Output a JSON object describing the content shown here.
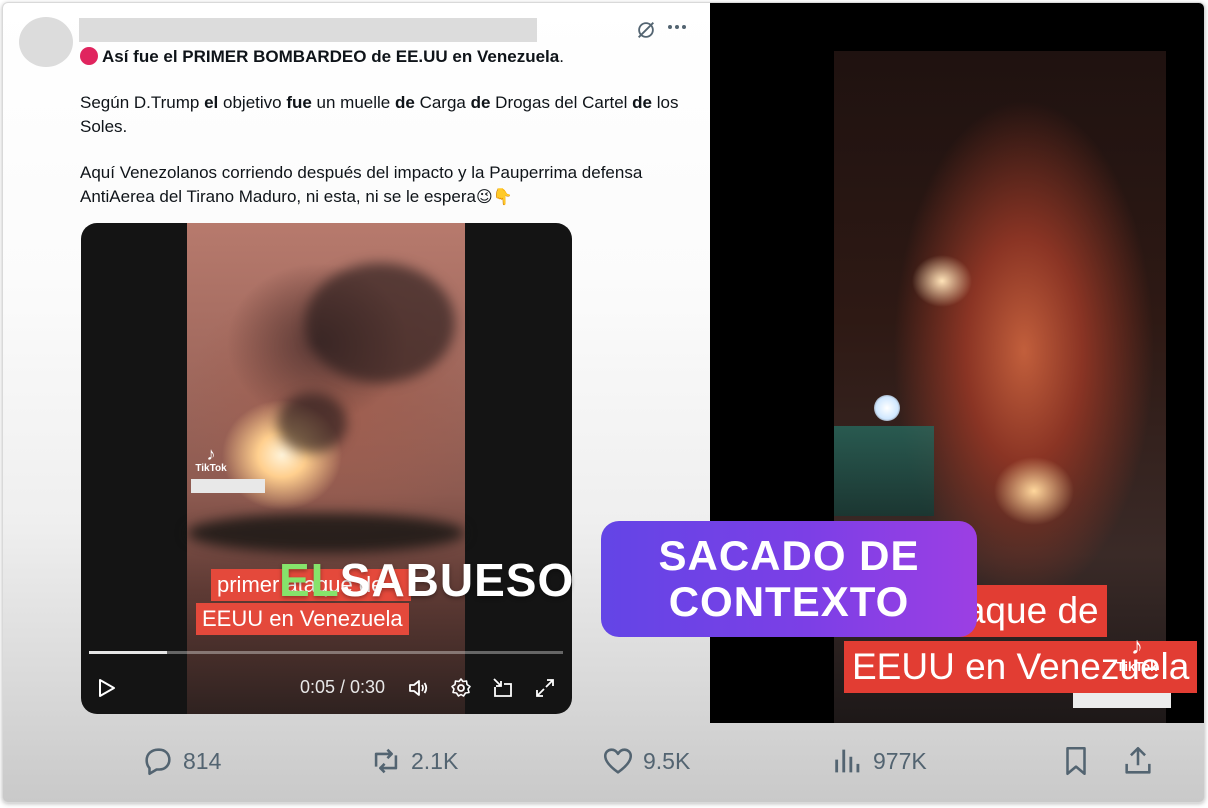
{
  "tweet": {
    "headline": "Así fue el PRIMER BOMBARDEO de EE.UU en Venezuela",
    "headline_end": ".",
    "para1": [
      {
        "t": "Según D.Trump ",
        "b": false
      },
      {
        "t": "el",
        "b": true
      },
      {
        "t": " objetivo ",
        "b": false
      },
      {
        "t": "fue",
        "b": true
      },
      {
        "t": " un muelle ",
        "b": false
      },
      {
        "t": "de",
        "b": true
      },
      {
        "t": " Carga ",
        "b": false
      },
      {
        "t": "de",
        "b": true
      },
      {
        "t": " Drogas del Cartel ",
        "b": false
      },
      {
        "t": "de",
        "b": true
      },
      {
        "t": " los Soles.",
        "b": false
      }
    ],
    "para2": "Aquí Venezolanos corriendo después del impacto y la Pauperrima defensa AntiAerea del Tirano Maduro, ni esta, ni se le espera",
    "emoji1": "😉",
    "emoji2": "👇"
  },
  "video": {
    "caption1": "primer ataque de",
    "caption2": "EEUU en Venezuela",
    "tiktok": "TikTok",
    "time": "0:05 / 0:30",
    "progress": 0.165
  },
  "side": {
    "caption1": "ataque de",
    "caption2": "EEUU en Venezuela",
    "tiktok": "TikTok"
  },
  "watermark": {
    "part1": "EL",
    "part2": "SABUESO"
  },
  "verdict": {
    "line1": "SACADO DE",
    "line2": "CONTEXTO"
  },
  "actions": {
    "replies": "814",
    "reposts": "2.1K",
    "likes": "9.5K",
    "views": "977K"
  },
  "colors": {
    "verdict_start": "#6345e6",
    "verdict_end": "#9c3fe3",
    "watermark_green": "#86e36b",
    "caption_red": "#e4493b",
    "action_gray": "#536471"
  }
}
